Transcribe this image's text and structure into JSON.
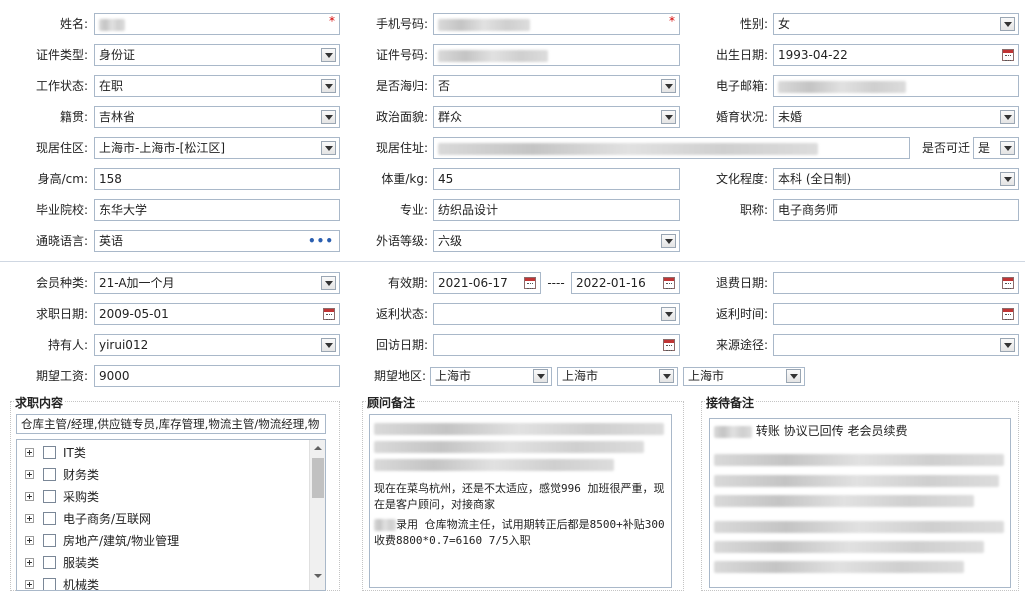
{
  "personal": {
    "name_label": "姓名:",
    "name_value": "",
    "phone_label": "手机号码:",
    "phone_value": "",
    "gender_label": "性别:",
    "gender_value": "女",
    "id_type_label": "证件类型:",
    "id_type_value": "身份证",
    "id_no_label": "证件号码:",
    "id_no_value": "",
    "birth_label": "出生日期:",
    "birth_value": "1993-04-22",
    "work_status_label": "工作状态:",
    "work_status_value": "在职",
    "returnee_label": "是否海归:",
    "returnee_value": "否",
    "email_label": "电子邮箱:",
    "email_value": "",
    "native_label": "籍贯:",
    "native_value": "吉林省",
    "political_label": "政治面貌:",
    "political_value": "群众",
    "marital_label": "婚育状况:",
    "marital_value": "未婚",
    "region_label": "现居住区:",
    "region_value": "上海市-上海市-[松江区]",
    "address_label": "现居住址:",
    "address_value": "",
    "relocate_label": "是否可迁",
    "relocate_value": "是",
    "height_label": "身高/cm:",
    "height_value": "158",
    "weight_label": "体重/kg:",
    "weight_value": "45",
    "education_label": "文化程度:",
    "education_value": "本科 (全日制)",
    "school_label": "毕业院校:",
    "school_value": "东华大学",
    "major_label": "专业:",
    "major_value": "纺织品设计",
    "title_label": "职称:",
    "title_value": "电子商务师",
    "language_label": "通晓语言:",
    "language_value": "英语",
    "lang_level_label": "外语等级:",
    "lang_level_value": "六级"
  },
  "membership": {
    "member_type_label": "会员种类:",
    "member_type_value": "21-A加一个月",
    "valid_label": "有效期:",
    "valid_from": "2021-06-17",
    "valid_sep": "----",
    "valid_to": "2022-01-16",
    "refund_date_label": "退费日期:",
    "refund_date_value": "",
    "job_date_label": "求职日期:",
    "job_date_value": "2009-05-01",
    "rebate_status_label": "返利状态:",
    "rebate_status_value": "",
    "rebate_time_label": "返利时间:",
    "rebate_time_value": "",
    "holder_label": "持有人:",
    "holder_value": "yirui012",
    "visit_date_label": "回访日期:",
    "visit_date_value": "",
    "source_label": "来源途径:",
    "source_value": "",
    "salary_label": "期望工资:",
    "salary_value": "9000",
    "area_label": "期望地区:",
    "area_1": "上海市",
    "area_2": "上海市",
    "area_3": "上海市"
  },
  "job_content": {
    "title": "求职内容",
    "summary": "仓库主管/经理,供应链专员,库存管理,物流主管/物流经理,物",
    "tree": [
      {
        "label": "IT类"
      },
      {
        "label": "财务类"
      },
      {
        "label": "采购类"
      },
      {
        "label": "电子商务/互联网"
      },
      {
        "label": "房地产/建筑/物业管理"
      },
      {
        "label": "服装类"
      },
      {
        "label": "机械类"
      }
    ]
  },
  "consultant_note": {
    "title": "顾问备注",
    "line1": "现在在菜鸟杭州，还是不太适应，感觉996  加班很严重，现在是客户顾问，对接商家",
    "line2": "录用  仓库物流主任，试用期转正后都是8500+补贴300",
    "line3": "收费8800*0.7=6160  7/5入职"
  },
  "reception_note": {
    "title": "接待备注",
    "line1": "转账 协议已回传  老会员续费"
  },
  "icons": {
    "dropdown": "chevron-down-icon",
    "calendar": "calendar-icon",
    "more": "ellipsis-icon",
    "expand": "plus-square-icon",
    "checkbox": "checkbox-icon"
  },
  "colors": {
    "border": "#a9b8c9",
    "required": "#d40000",
    "link_dots": "#2b5fb0"
  }
}
